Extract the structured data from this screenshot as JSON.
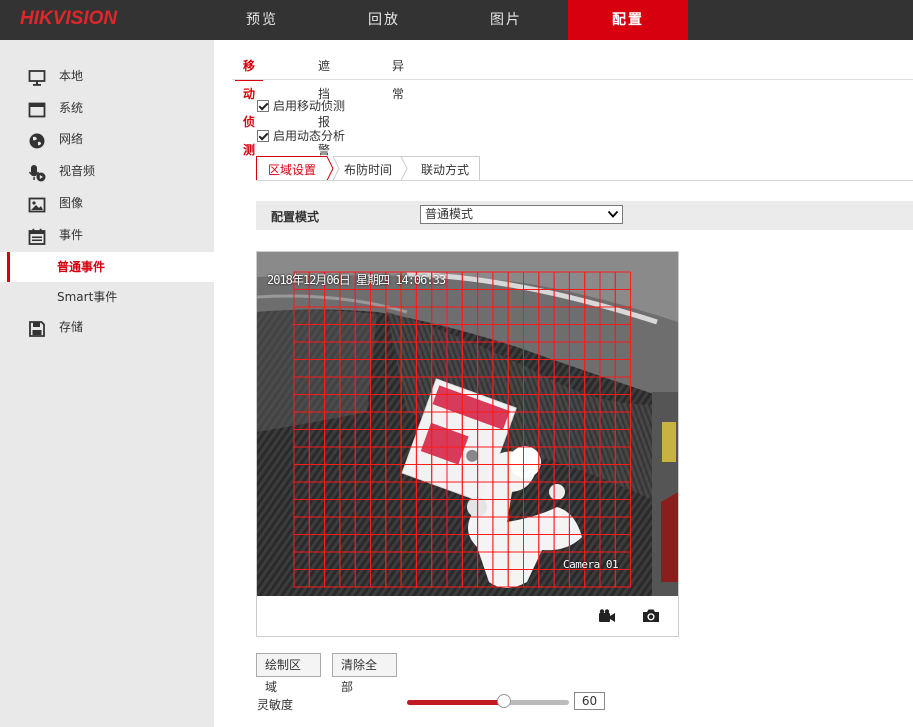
{
  "header": {
    "logo": "HIKVISION",
    "nav": [
      {
        "label": "预览"
      },
      {
        "label": "回放"
      },
      {
        "label": "图片"
      },
      {
        "label": "配置"
      }
    ],
    "active_nav": 3
  },
  "sidebar": {
    "items": [
      {
        "label": "本地",
        "icon": "monitor-icon"
      },
      {
        "label": "系统",
        "icon": "window-icon"
      },
      {
        "label": "网络",
        "icon": "globe-icon"
      },
      {
        "label": "视音频",
        "icon": "microphone-icon"
      },
      {
        "label": "图像",
        "icon": "image-icon"
      },
      {
        "label": "事件",
        "icon": "calendar-icon"
      },
      {
        "label": "存储",
        "icon": "floppy-icon"
      }
    ],
    "sub_items": [
      {
        "label": "普通事件",
        "active": true
      },
      {
        "label": "Smart事件",
        "active": false
      }
    ]
  },
  "main": {
    "tabs": [
      {
        "label": "移动侦测"
      },
      {
        "label": "遮挡报警"
      },
      {
        "label": "异常"
      }
    ],
    "active_tab": 0,
    "checkboxes": [
      {
        "label": "启用移动侦测",
        "checked": true
      },
      {
        "label": "启用动态分析",
        "checked": true
      }
    ],
    "subtabs": [
      {
        "label": "区域设置"
      },
      {
        "label": "布防时间"
      },
      {
        "label": "联动方式"
      }
    ],
    "config_mode": {
      "label": "配置模式",
      "value": "普通模式"
    },
    "video": {
      "osd_datetime": "2018年12月06日 星期四 14:06:33",
      "osd_camera": "Camera 01",
      "grid_color": "#ff1a1a",
      "toolbar_icons": [
        "video-record-icon",
        "camera-snapshot-icon"
      ]
    },
    "buttons": {
      "draw_area": "绘制区域",
      "clear_all": "清除全部"
    },
    "sensitivity": {
      "label": "灵敏度",
      "value": "60",
      "fraction": 0.6
    }
  },
  "colors": {
    "accent": "#d7000f",
    "topbar": "#333333",
    "sidebar": "#e9e9e9"
  }
}
